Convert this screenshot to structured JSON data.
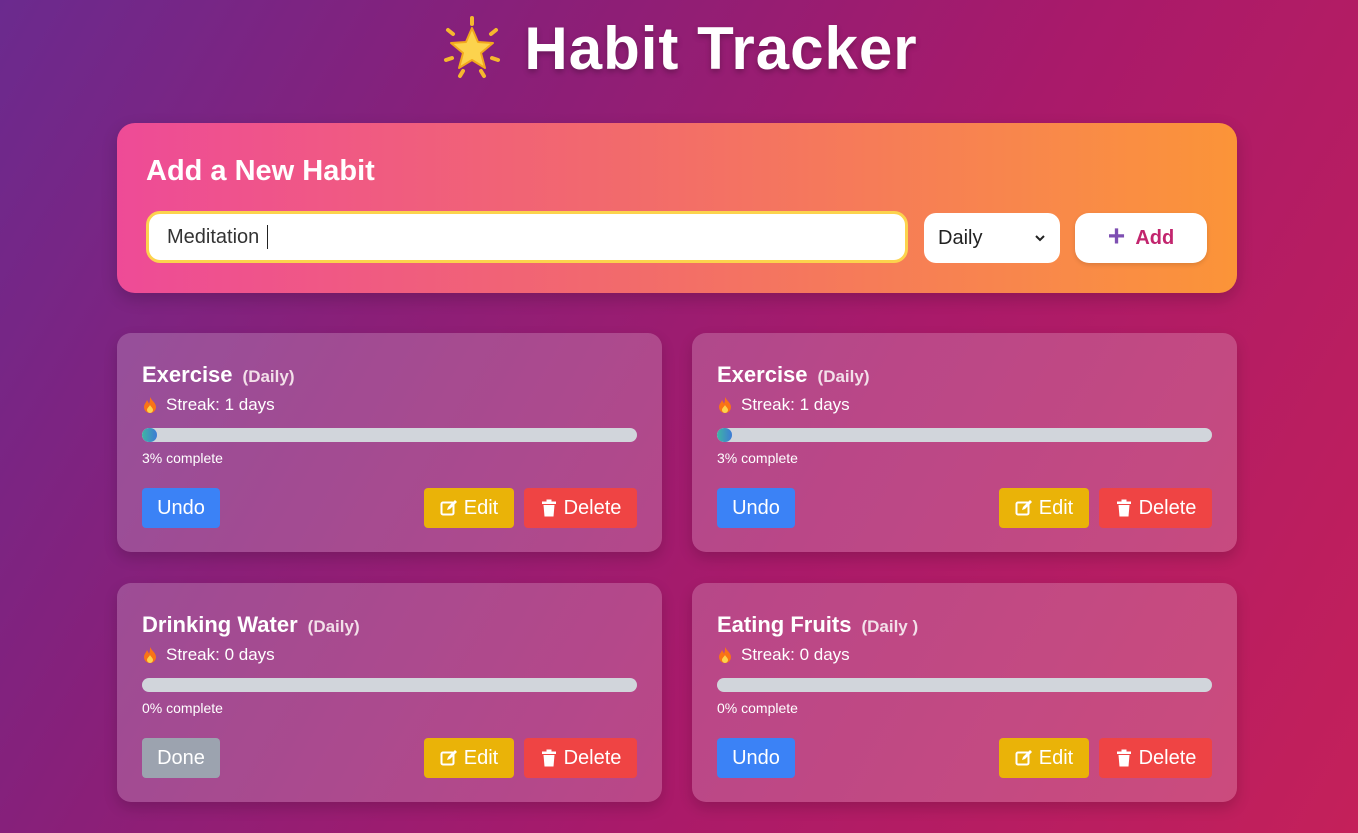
{
  "header": {
    "title": "Habit Tracker",
    "icon": "star-icon"
  },
  "add_form": {
    "heading": "Add a New Habit",
    "input_value": "Meditation",
    "frequency_selected": "Daily",
    "add_label": "Add"
  },
  "habits": [
    {
      "name": "Exercise",
      "frequency": "(Daily)",
      "streak": "Streak: 1 days",
      "progress_percent": 3,
      "progress_text": "3% complete",
      "toggle_label": "Undo",
      "toggle_state": "undo",
      "edit_label": "Edit",
      "delete_label": "Delete"
    },
    {
      "name": "Exercise",
      "frequency": "(Daily)",
      "streak": "Streak: 1 days",
      "progress_percent": 3,
      "progress_text": "3% complete",
      "toggle_label": "Undo",
      "toggle_state": "undo",
      "edit_label": "Edit",
      "delete_label": "Delete"
    },
    {
      "name": "Drinking Water",
      "frequency": "(Daily)",
      "streak": "Streak: 0 days",
      "progress_percent": 0,
      "progress_text": "0% complete",
      "toggle_label": "Done",
      "toggle_state": "done",
      "edit_label": "Edit",
      "delete_label": "Delete"
    },
    {
      "name": "Eating Fruits",
      "frequency": "(Daily )",
      "streak": "Streak: 0 days",
      "progress_percent": 0,
      "progress_text": "0% complete",
      "toggle_label": "Undo",
      "toggle_state": "undo",
      "edit_label": "Edit",
      "delete_label": "Delete"
    }
  ],
  "colors": {
    "undo": "#3b82f6",
    "done": "#9ca3af",
    "edit": "#eab308",
    "delete": "#ef4444",
    "add_text": "#c2256e"
  }
}
